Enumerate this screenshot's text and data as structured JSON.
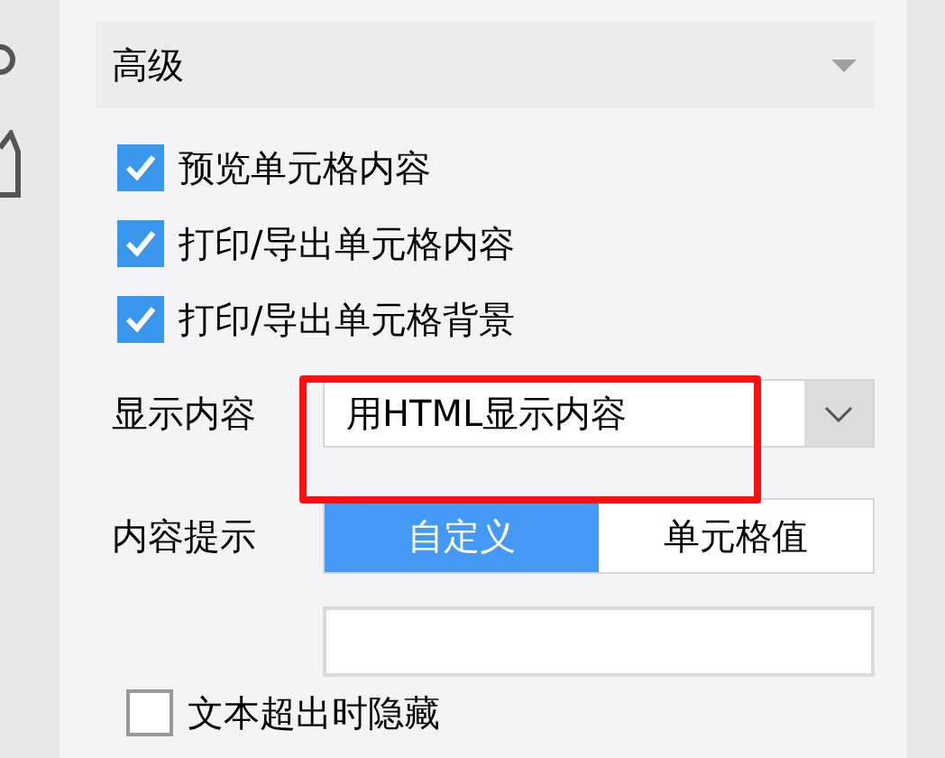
{
  "section": {
    "title": "高级",
    "expanded": true
  },
  "options": [
    {
      "label": "预览单元格内容",
      "checked": true
    },
    {
      "label": "打印/导出单元格内容",
      "checked": true
    },
    {
      "label": "打印/导出单元格背景",
      "checked": true
    }
  ],
  "display_content": {
    "label": "显示内容",
    "value": "用HTML显示内容",
    "highlighted": true
  },
  "content_hint": {
    "label": "内容提示",
    "segments": [
      {
        "label": "自定义",
        "selected": true
      },
      {
        "label": "单元格值",
        "selected": false
      }
    ]
  },
  "bottom_options": [
    {
      "label": "文本超出时隐藏",
      "checked": false
    }
  ]
}
